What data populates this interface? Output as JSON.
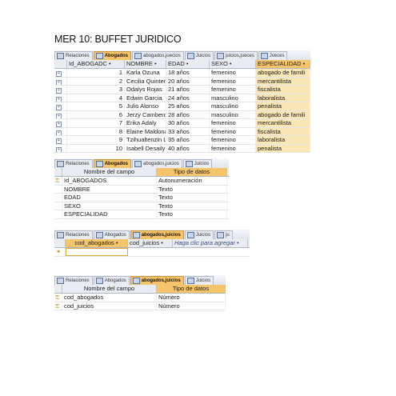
{
  "title": "MER 10: BUFFET JURIDICO",
  "abogados_view": {
    "tabs": [
      "Relaciones",
      "Abogados",
      "abogados,juecios",
      "Juicios",
      "juicios,jueces",
      "Jveces"
    ],
    "active_tab": 1,
    "columns": [
      "Id_ABOGADC •",
      "NOMBRE •",
      "EDAD •",
      "SEXO •",
      "ESPECIALIDAD •"
    ],
    "rows": [
      {
        "id": "1",
        "nombre": "Karla Ozuna",
        "edad": "18 años",
        "sexo": "femenino",
        "esp": "abogado de famili"
      },
      {
        "id": "2",
        "nombre": "Cecilia Quinterc",
        "edad": "20 años",
        "sexo": "femenino",
        "esp": "mercantilista"
      },
      {
        "id": "3",
        "nombre": "Odalys Rojas",
        "edad": "21 años",
        "sexo": "femenino",
        "esp": "fiscalista"
      },
      {
        "id": "4",
        "nombre": "Edwin Garcia",
        "edad": "24 años",
        "sexo": "masculino",
        "esp": "laboralista"
      },
      {
        "id": "5",
        "nombre": "Julio Alonso",
        "edad": "25 años",
        "sexo": "masculino",
        "esp": "penalista"
      },
      {
        "id": "6",
        "nombre": "Jerzy Cambero",
        "edad": "28 años",
        "sexo": "masculino",
        "esp": "abogado de famili"
      },
      {
        "id": "7",
        "nombre": "Erika Adaly",
        "edad": "30 años",
        "sexo": "femenino",
        "esp": "mercantilista"
      },
      {
        "id": "8",
        "nombre": "Elaine Maldona",
        "edad": "33 años",
        "sexo": "femenino",
        "esp": "fiscalista"
      },
      {
        "id": "9",
        "nombre": "Tzihualtenzin Lu",
        "edad": "35 años",
        "sexo": "femenino",
        "esp": "laboralista"
      },
      {
        "id": "10",
        "nombre": "Isabell Desaily",
        "edad": "40 años",
        "sexo": "femenino",
        "esp": "penalista"
      }
    ]
  },
  "abogados_design": {
    "tabs": [
      "Relaciones",
      "Abogados",
      "abogados,juicios",
      "Juicios"
    ],
    "active_tab": 1,
    "columns": [
      "Nombre del campo",
      "Tipo de datos"
    ],
    "rows": [
      {
        "campo": "Id_ABOGADOS",
        "tipo": "Autonumeración",
        "key": true
      },
      {
        "campo": "NOMBRE",
        "tipo": "Texto",
        "key": false
      },
      {
        "campo": "EDAD",
        "tipo": "Texto",
        "key": false
      },
      {
        "campo": "SEXO",
        "tipo": "Texto",
        "key": false
      },
      {
        "campo": "ESPECIALIDAD",
        "tipo": "Texto",
        "key": false
      }
    ]
  },
  "junction_view": {
    "tabs": [
      "Relaciones",
      "Abogados",
      "abogados,juicios",
      "Juicios",
      "ju"
    ],
    "active_tab": 2,
    "columns": [
      "cod_abogados •",
      "cod_juicios •",
      "Haga clic para agregar •"
    ]
  },
  "junction_design": {
    "tabs": [
      "Relaciones",
      "Abogados",
      "abogados,juicios",
      "Juicios"
    ],
    "active_tab": 2,
    "columns": [
      "Nombre del campo",
      "Tipo de datos"
    ],
    "rows": [
      {
        "campo": "cod_abogados",
        "tipo": "Número",
        "key": true
      },
      {
        "campo": "cod_juicios",
        "tipo": "Número",
        "key": true
      }
    ]
  }
}
